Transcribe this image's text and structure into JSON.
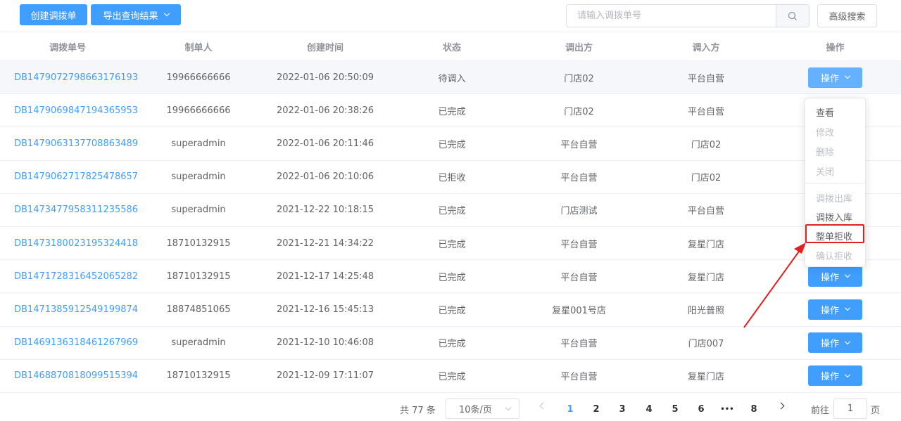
{
  "toolbar": {
    "create_label": "创建调拨单",
    "export_label": "导出查询结果",
    "search_placeholder": "请输入调拨单号",
    "advanced_label": "高级搜索"
  },
  "table": {
    "headers": [
      "调拨单号",
      "制单人",
      "创建时间",
      "状态",
      "调出方",
      "调入方",
      "操作"
    ],
    "action_label": "操作",
    "rows": [
      {
        "id": "DB1479072798663176193",
        "creator": "19966666666",
        "time": "2022-01-06 20:50:09",
        "status": "待调入",
        "from": "门店02",
        "to": "平台自营"
      },
      {
        "id": "DB1479069847194365953",
        "creator": "19966666666",
        "time": "2022-01-06 20:38:26",
        "status": "已完成",
        "from": "门店02",
        "to": "平台自营"
      },
      {
        "id": "DB1479063137708863489",
        "creator": "superadmin",
        "time": "2022-01-06 20:11:46",
        "status": "已完成",
        "from": "平台自营",
        "to": "门店02"
      },
      {
        "id": "DB1479062717825478657",
        "creator": "superadmin",
        "time": "2022-01-06 20:10:06",
        "status": "已拒收",
        "from": "平台自营",
        "to": "门店02"
      },
      {
        "id": "DB1473477958311235586",
        "creator": "superadmin",
        "time": "2021-12-22 10:18:15",
        "status": "已完成",
        "from": "门店测试",
        "to": "平台自营"
      },
      {
        "id": "DB1473180023195324418",
        "creator": "18710132915",
        "time": "2021-12-21 14:34:22",
        "status": "已完成",
        "from": "平台自营",
        "to": "复星门店"
      },
      {
        "id": "DB1471728316452065282",
        "creator": "18710132915",
        "time": "2021-12-17 14:25:48",
        "status": "已完成",
        "from": "平台自营",
        "to": "复星门店"
      },
      {
        "id": "DB1471385912549199874",
        "creator": "18874851065",
        "time": "2021-12-16 15:45:13",
        "status": "已完成",
        "from": "复星001号店",
        "to": "阳光普照"
      },
      {
        "id": "DB1469136318461267969",
        "creator": "superadmin",
        "time": "2021-12-10 10:46:08",
        "status": "已完成",
        "from": "平台自营",
        "to": "门店007"
      },
      {
        "id": "DB1468870818099515394",
        "creator": "18710132915",
        "time": "2021-12-09 17:11:07",
        "status": "已完成",
        "from": "平台自营",
        "to": "复星门店"
      }
    ]
  },
  "dropdown": {
    "items": [
      {
        "label": "查看",
        "disabled": false
      },
      {
        "label": "修改",
        "disabled": true
      },
      {
        "label": "删除",
        "disabled": true
      },
      {
        "label": "关闭",
        "disabled": true
      },
      {
        "label": "调拨出库",
        "disabled": true
      },
      {
        "label": "调拨入库",
        "disabled": false
      },
      {
        "label": "整单拒收",
        "disabled": false
      },
      {
        "label": "确认拒收",
        "disabled": true
      }
    ]
  },
  "pagination": {
    "total": "共 77 条",
    "page_size": "10条/页",
    "pages": [
      "1",
      "2",
      "3",
      "4",
      "5",
      "6",
      "•••",
      "8"
    ],
    "current": "1",
    "goto_label": "前往",
    "goto_value": "1",
    "goto_unit": "页"
  },
  "colors": {
    "primary": "#409eff",
    "highlight": "#e02020"
  }
}
